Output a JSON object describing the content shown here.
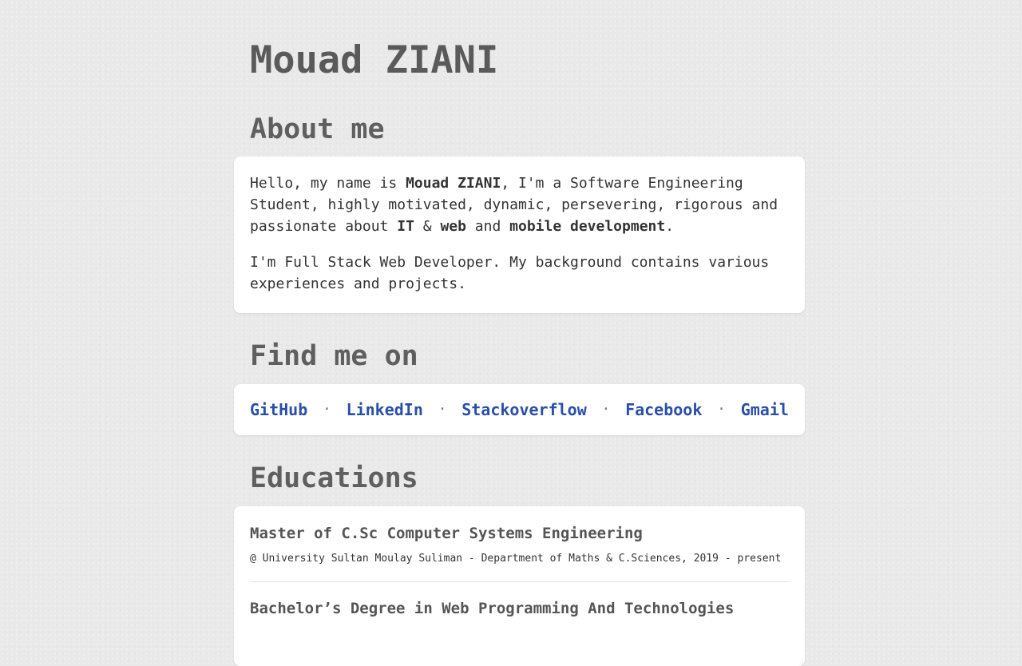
{
  "header": {
    "name": "Mouad ZIANI"
  },
  "about": {
    "title": "About me",
    "p1": {
      "t1": "Hello, my name is ",
      "b1": "Mouad ZIANI",
      "t2": ", I'm a Software Engineering Student, highly motivated, dynamic, persevering, rigorous and passionate about ",
      "b2": "IT",
      "t3": " & ",
      "b3": "web",
      "t4": " and ",
      "b4": "mobile development",
      "t5": "."
    },
    "p2": "I'm Full Stack Web Developer. My background contains various experiences and projects."
  },
  "find": {
    "title": "Find me on",
    "separator": "·",
    "links": [
      {
        "label": "GitHub"
      },
      {
        "label": "LinkedIn"
      },
      {
        "label": "Stackoverflow"
      },
      {
        "label": "Facebook"
      },
      {
        "label": "Gmail"
      }
    ]
  },
  "education": {
    "title": "Educations",
    "items": [
      {
        "degree": "Master of C.Sc Computer Systems Engineering",
        "meta": "@ University Sultan Moulay Suliman - Department of Maths & C.Sciences, 2019 - present"
      },
      {
        "degree": "Bachelor’s Degree in Web Programming And Technologies"
      }
    ]
  }
}
